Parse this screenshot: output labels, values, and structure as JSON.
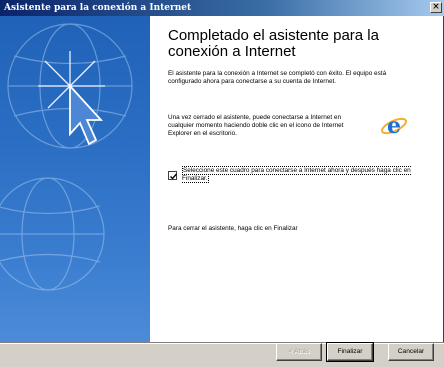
{
  "window": {
    "title": "Asistente para la conexión a Internet",
    "close_glyph": "×"
  },
  "main": {
    "heading": "Completado el asistente para la conexión a Internet",
    "paragraph1": "El asistente para la conexión a Internet se completó con éxito. El equipo está configurado ahora para conectarse a su cuenta de Internet.",
    "paragraph2": "Una vez cerrado el asistente, puede conectarse a Internet en cualquier momento haciendo doble clic en el icono de Internet Explorer en el escritorio.",
    "checkbox": {
      "label": "Seleccione este cuadro para conectarse a Internet ahora y después haga clic en Finalizar.",
      "checked": true
    },
    "paragraph3": "Para cerrar el asistente, haga clic en Finalizar"
  },
  "buttons": {
    "back": "< Atrás",
    "finish": "Finalizar",
    "cancel": "Cancelar"
  },
  "colors": {
    "side_panel": "#2b6fc4",
    "titlebar": "#0a246a",
    "ie_blue": "#1e6fd0"
  },
  "icons": [
    "internet-explorer-icon",
    "globe-graphic",
    "cursor-arrow-graphic",
    "checkmark-icon"
  ]
}
